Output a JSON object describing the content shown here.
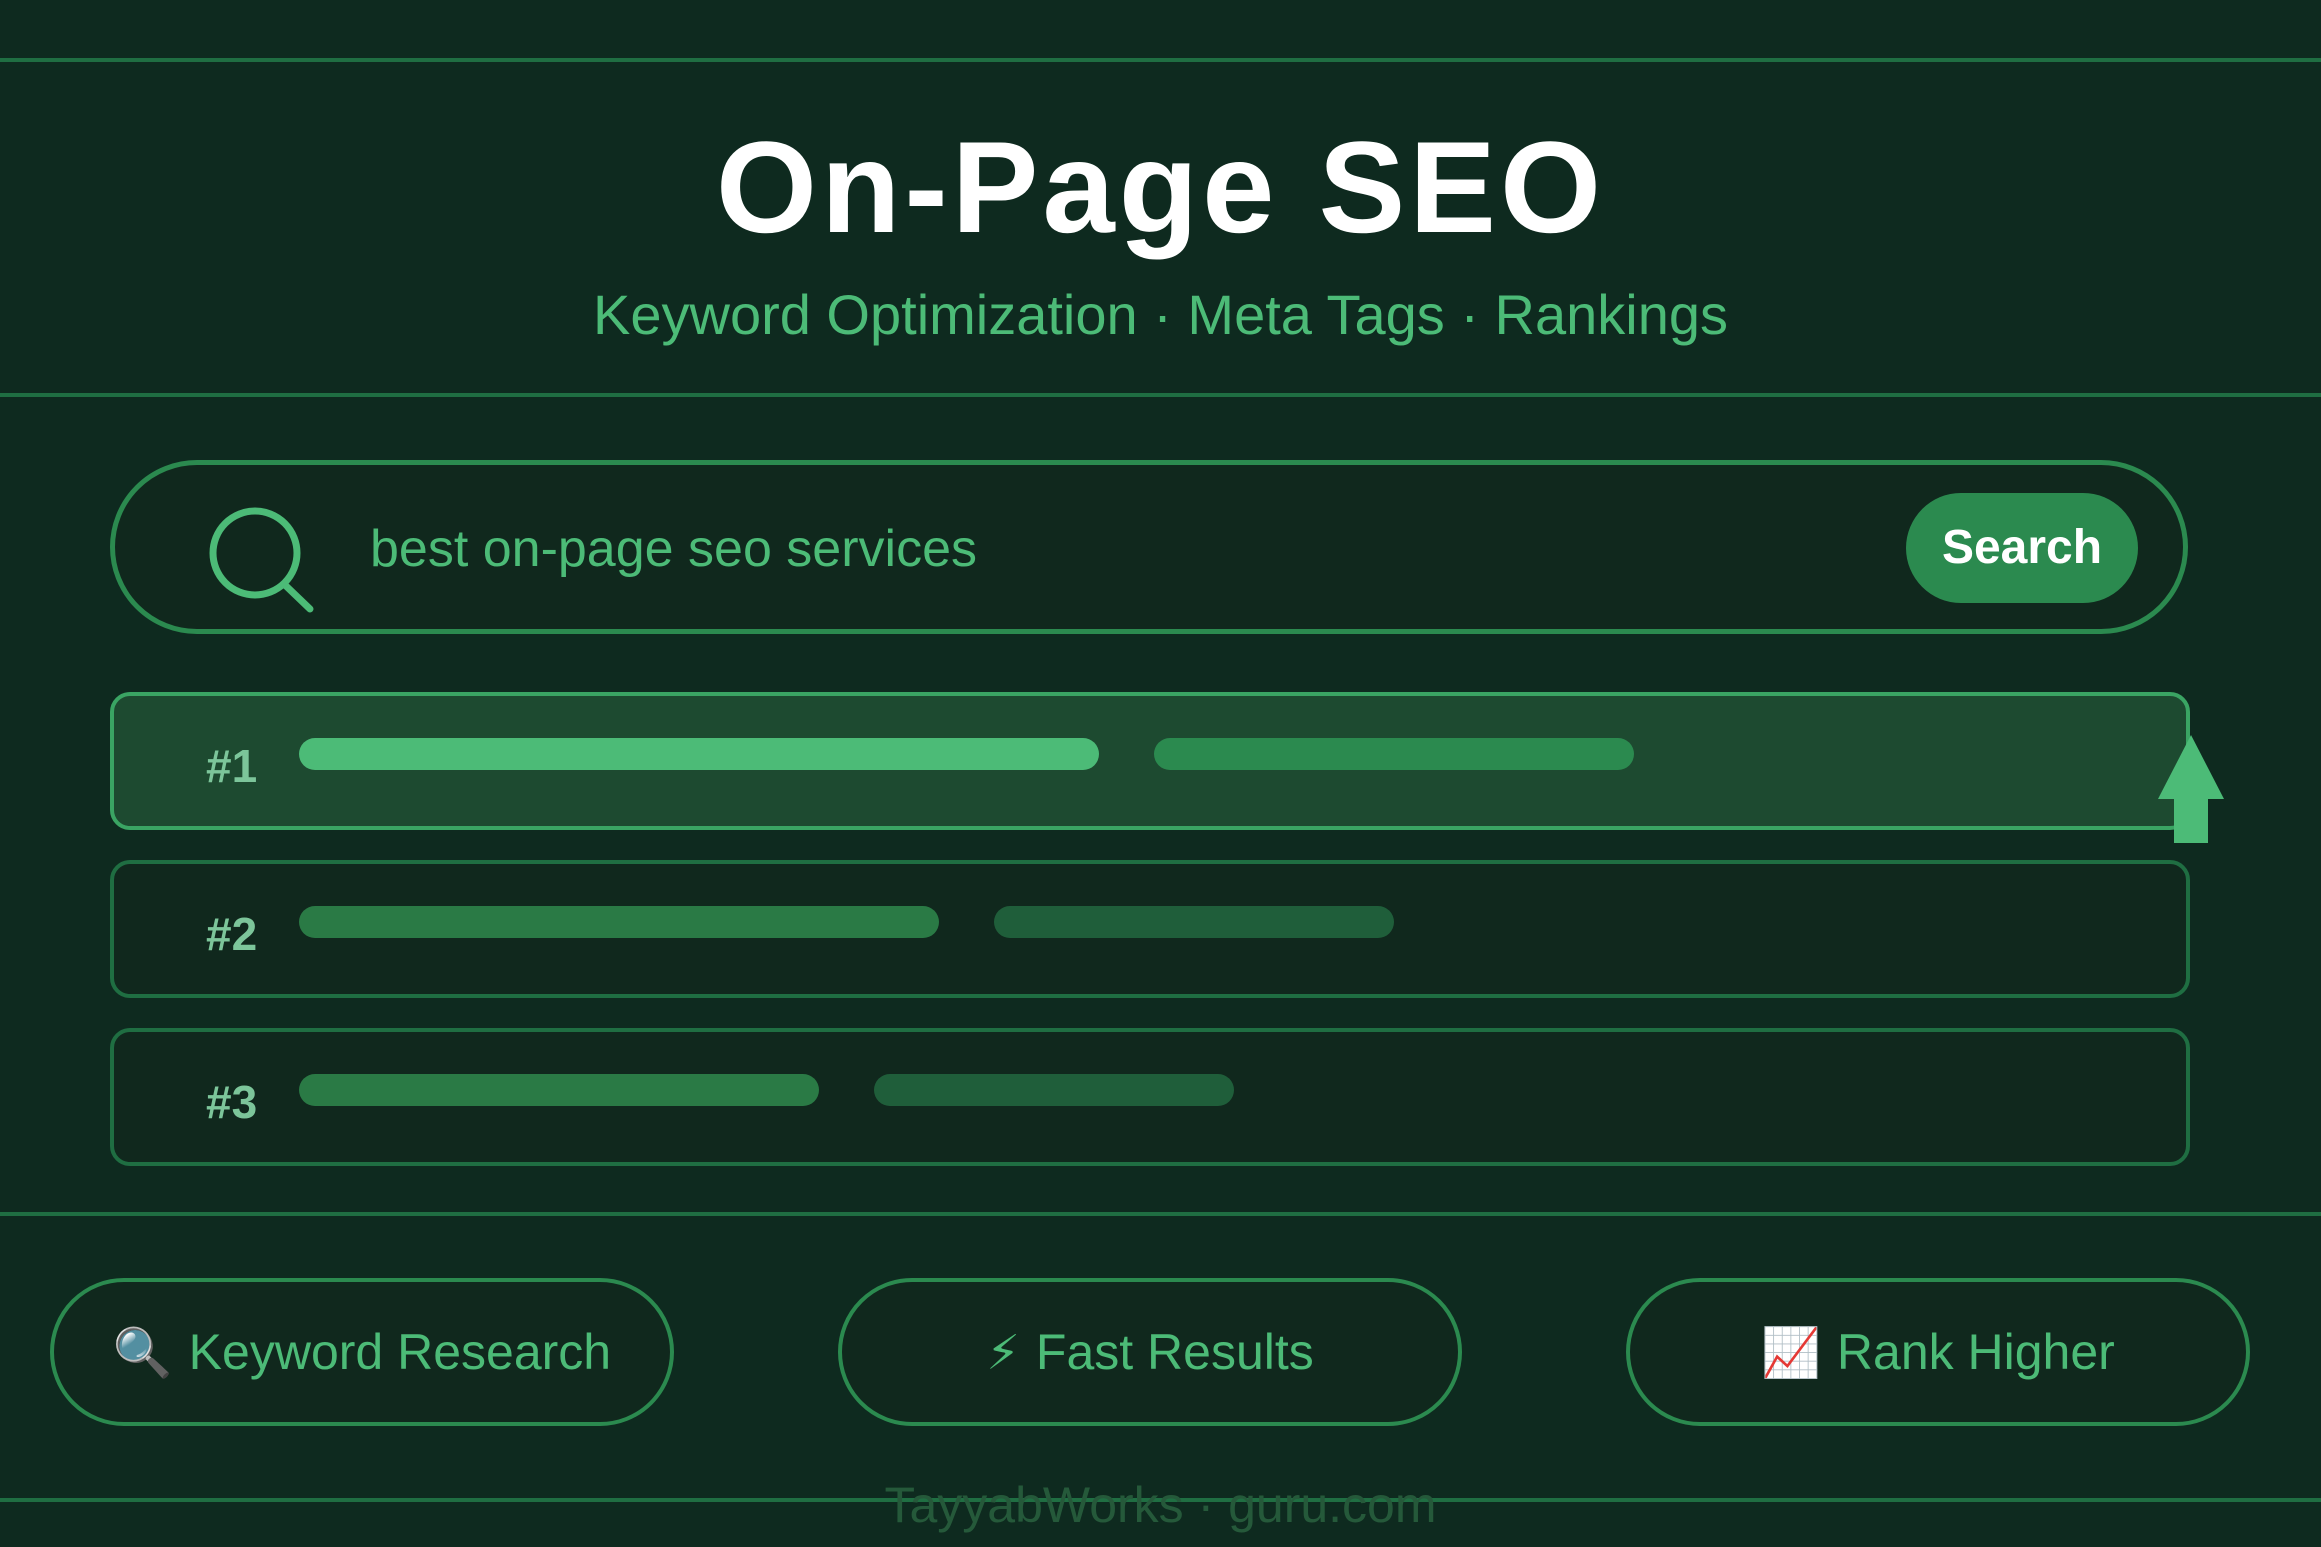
{
  "header": {
    "title": "On-Page SEO",
    "subtitle": "Keyword Optimization · Meta Tags · Rankings"
  },
  "search": {
    "icon": "search-icon",
    "query": "best on-page seo services",
    "button_label": "Search"
  },
  "results": [
    {
      "rank": "#1",
      "highlighted": true
    },
    {
      "rank": "#2",
      "highlighted": false
    },
    {
      "rank": "#3",
      "highlighted": false
    }
  ],
  "rank_indicator_icon": "up-arrow-icon",
  "features": [
    {
      "emoji": "🔍",
      "icon": "magnifier-icon",
      "label": "Keyword Research"
    },
    {
      "emoji": "⚡",
      "icon": "lightning-icon",
      "label": "Fast Results"
    },
    {
      "emoji": "📈",
      "icon": "chart-up-icon",
      "label": "Rank Higher"
    }
  ],
  "footer": {
    "text": "TayyabWorks · guru.com"
  },
  "colors": {
    "background": "#0e2a1f",
    "accent": "#2b8a4f",
    "accent_light": "#4cbb77",
    "text_primary": "#ffffff"
  }
}
